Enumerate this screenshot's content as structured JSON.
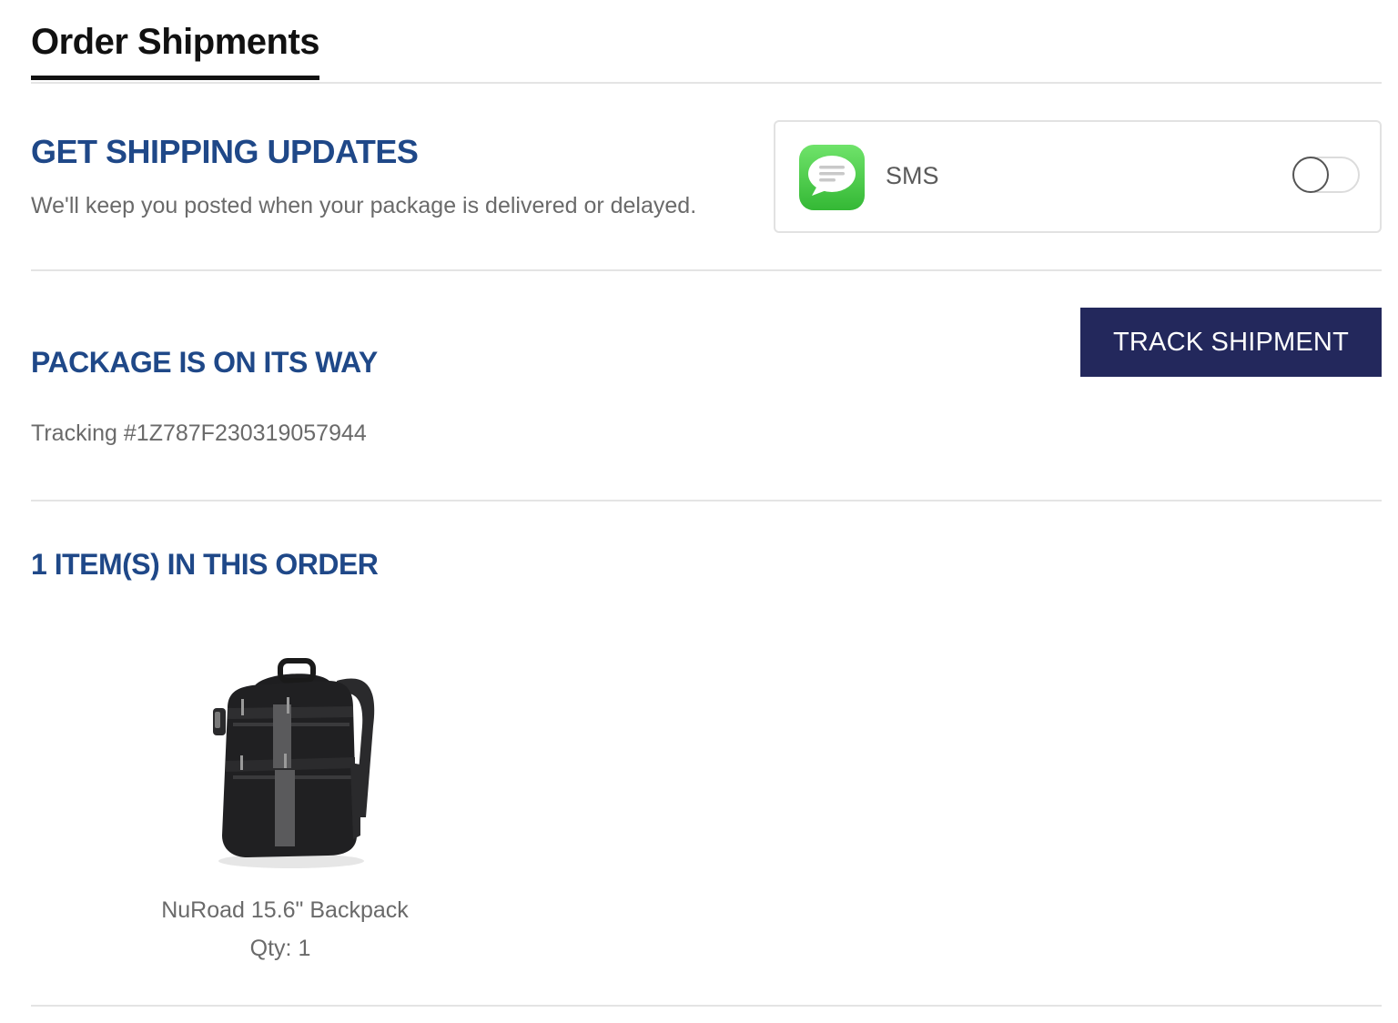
{
  "header": {
    "tab_title": "Order Shipments"
  },
  "shipping_updates": {
    "heading": "GET SHIPPING UPDATES",
    "description": "We'll keep you posted when your package is delivered or delayed.",
    "channel": {
      "label": "SMS",
      "icon": "messages-app-icon",
      "enabled": false
    }
  },
  "package": {
    "heading": "PACKAGE IS ON ITS WAY",
    "tracking_text": "Tracking #1Z787F230319057944",
    "track_button_label": "TRACK SHIPMENT"
  },
  "items": {
    "heading": "1 ITEM(S) IN THIS ORDER",
    "list": [
      {
        "name": "NuRoad 15.6\" Backpack",
        "qty_label": "Qty:",
        "qty": "1",
        "image_icon": "backpack-image"
      }
    ]
  },
  "colors": {
    "heading_blue": "#1f4888",
    "button_navy": "#23285c",
    "sms_green": "#4cc84a",
    "text_gray": "#6a6a6a"
  }
}
